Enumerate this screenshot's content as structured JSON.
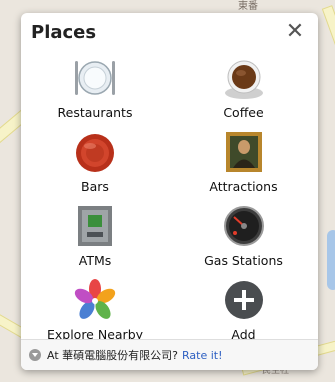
{
  "map": {
    "top_label": "東番",
    "bottom_label": "民生社"
  },
  "dialog": {
    "title": "Places",
    "close_glyph": "✕",
    "items": [
      {
        "label": "Restaurants",
        "icon": "plate-icon"
      },
      {
        "label": "Coffee",
        "icon": "coffee-cup-icon"
      },
      {
        "label": "Bars",
        "icon": "bottle-cap-icon"
      },
      {
        "label": "Attractions",
        "icon": "framed-painting-icon"
      },
      {
        "label": "ATMs",
        "icon": "atm-machine-icon"
      },
      {
        "label": "Gas Stations",
        "icon": "fuel-gauge-icon"
      },
      {
        "label": "Explore Nearby",
        "icon": "pinwheel-icon"
      },
      {
        "label": "Add",
        "icon": "plus-circle-icon"
      }
    ],
    "footer": {
      "prompt": "At 華碩電腦股份有限公司?",
      "rate_link": "Rate it!"
    }
  }
}
